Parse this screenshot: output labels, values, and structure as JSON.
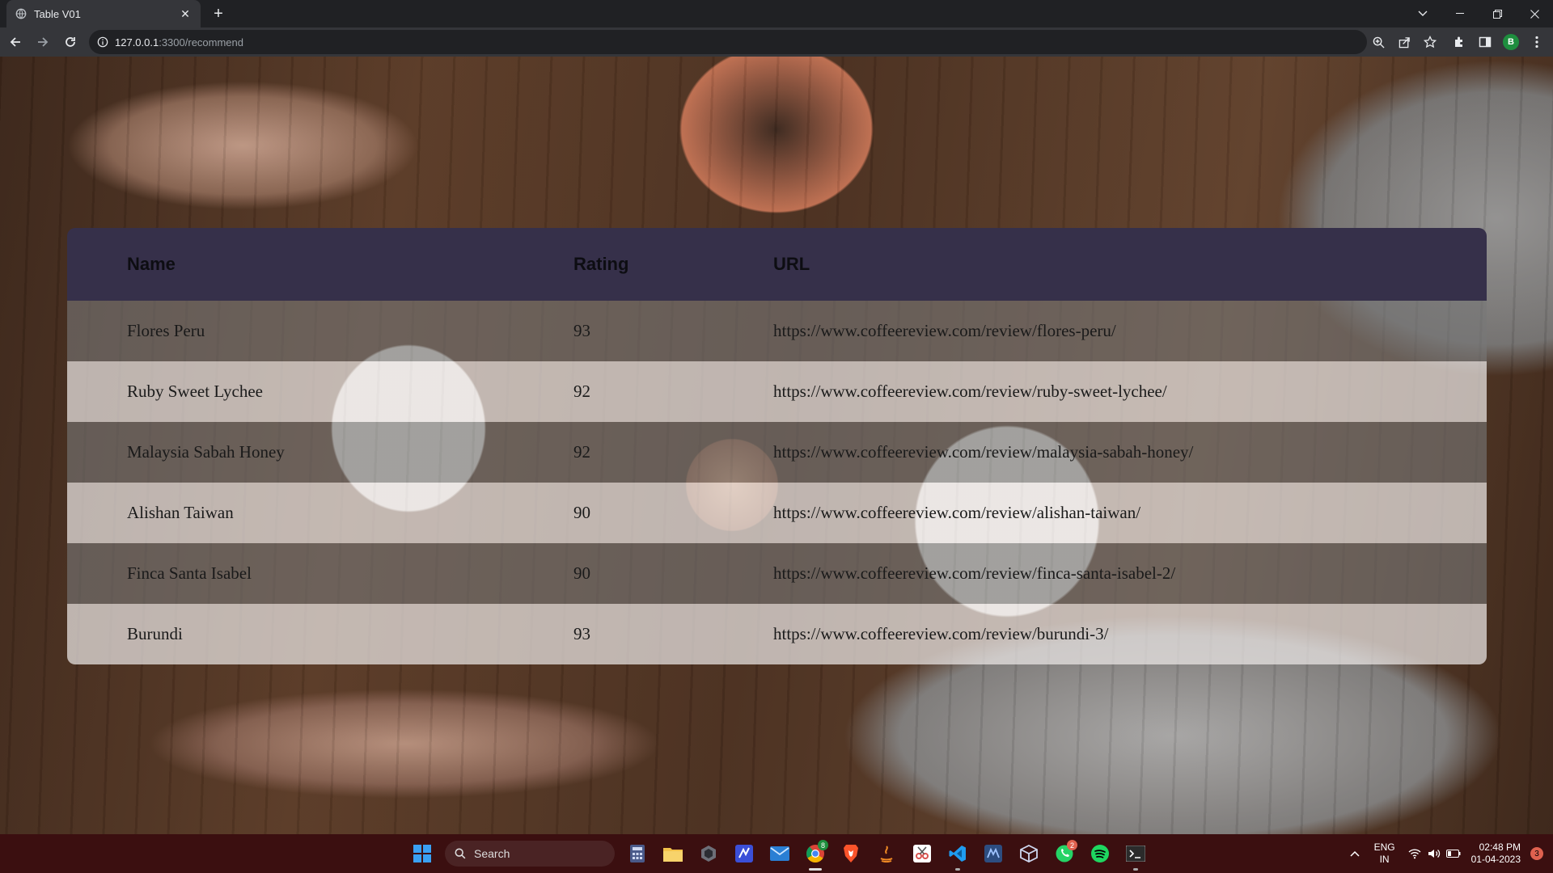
{
  "browser": {
    "tab_title": "Table V01",
    "url_host": "127.0.0.1",
    "url_path": ":3300/recommend",
    "profile_initial": "B"
  },
  "table": {
    "headers": {
      "name": "Name",
      "rating": "Rating",
      "url": "URL"
    },
    "rows": [
      {
        "name": "Flores Peru",
        "rating": "93",
        "url": "https://www.coffeereview.com/review/flores-peru/"
      },
      {
        "name": "Ruby Sweet Lychee",
        "rating": "92",
        "url": "https://www.coffeereview.com/review/ruby-sweet-lychee/"
      },
      {
        "name": "Malaysia Sabah Honey",
        "rating": "92",
        "url": "https://www.coffeereview.com/review/malaysia-sabah-honey/"
      },
      {
        "name": "Alishan Taiwan",
        "rating": "90",
        "url": "https://www.coffeereview.com/review/alishan-taiwan/"
      },
      {
        "name": "Finca Santa Isabel",
        "rating": "90",
        "url": "https://www.coffeereview.com/review/finca-santa-isabel-2/"
      },
      {
        "name": "Burundi",
        "rating": "93",
        "url": "https://www.coffeereview.com/review/burundi-3/"
      }
    ]
  },
  "taskbar": {
    "search_label": "Search",
    "lang_line1": "ENG",
    "lang_line2": "IN",
    "time": "02:48 PM",
    "date": "01-04-2023",
    "notifications": "3",
    "whatsapp_badge": "2",
    "chrome_badge": "8"
  },
  "colors": {
    "header_bg": "#36304a",
    "taskbar_bg": "#3b0f10"
  }
}
